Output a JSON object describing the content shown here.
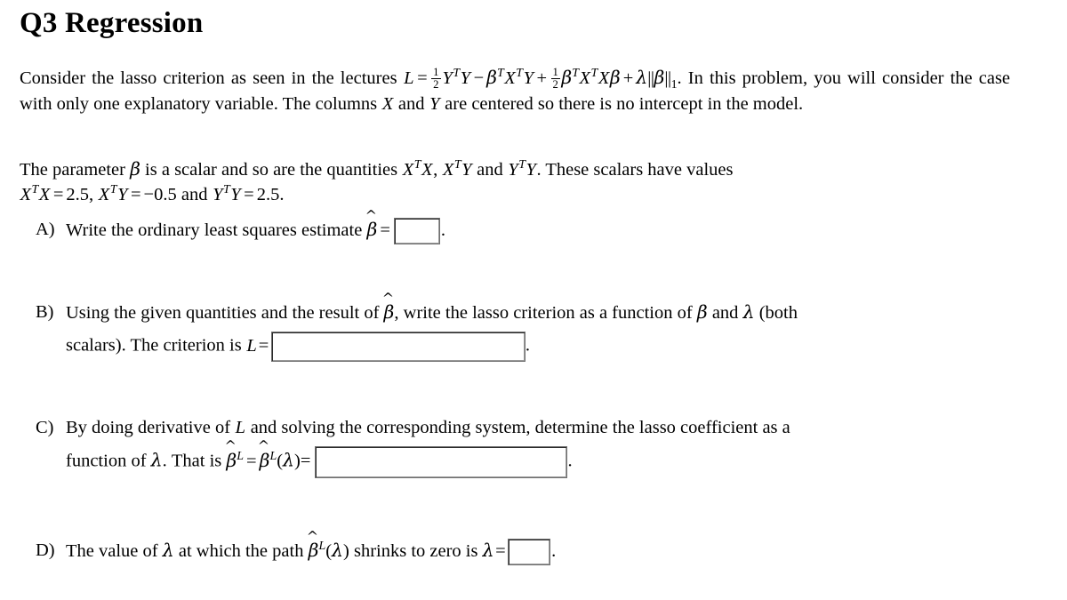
{
  "document": {
    "title": "Q3 Regression",
    "intro": {
      "before_formula": "Consider the lasso criterion as seen in the lectures",
      "formula_text": "L = ½YᵀY − βᵀXᵀY + ½βᵀXᵀXβ + λ||β||₁",
      "after_formula": ". In this problem, you will consider the case with only one explanatory variable. The columns X and Y are centered so there is no intercept in the model."
    },
    "given": {
      "sentence_1": "The parameter β is a scalar and so are the quantities XᵀX, XᵀY and YᵀY. These scalars have values",
      "values_text": "XᵀX = 2.5, XᵀY = −0.5 and YᵀY = 2.5.",
      "XtX": "2.5",
      "XtY": "-0.5",
      "YtY": "2.5"
    },
    "questions": [
      {
        "marker": "A)",
        "text": "Write the ordinary least squares estimate β̂ =",
        "answer_value": "",
        "box_size": "small"
      },
      {
        "marker": "B)",
        "line1": "Using the given quantities and the result of β̂, write the lasso criterion as a function of β and λ (both",
        "line2": "scalars). The criterion is L =",
        "answer_value": "",
        "box_size": "wide"
      },
      {
        "marker": "C)",
        "line1": "By doing derivative of L and solving the corresponding system, determine the lasso coefficient as a",
        "line2": "function of λ. That is β̂ᴸ = β̂ᴸ(λ)=",
        "answer_value": "",
        "box_size": "wide2"
      },
      {
        "marker": "D)",
        "text": "The value of λ at which the path β̂ᴸ(λ) shrinks to zero is λ =",
        "answer_value": "",
        "box_size": "xsmall"
      }
    ]
  },
  "colors": {
    "text": "#000000",
    "page_background": "#ffffff",
    "box_border": "#6f6f6f",
    "box_border_dark": "#2b2b2b"
  }
}
